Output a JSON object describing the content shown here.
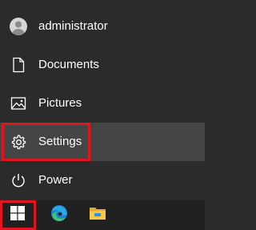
{
  "start_menu": {
    "items": [
      {
        "label": "administrator",
        "icon": "user-avatar-icon"
      },
      {
        "label": "Documents",
        "icon": "document-icon"
      },
      {
        "label": "Pictures",
        "icon": "picture-icon"
      },
      {
        "label": "Settings",
        "icon": "gear-icon"
      },
      {
        "label": "Power",
        "icon": "power-icon"
      }
    ],
    "highlighted_item": "Settings"
  },
  "taskbar": {
    "buttons": [
      {
        "name": "start",
        "icon": "windows-logo-icon"
      },
      {
        "name": "edge",
        "icon": "edge-browser-icon"
      },
      {
        "name": "file-explorer",
        "icon": "folder-icon"
      }
    ]
  },
  "colors": {
    "menu_bg": "#2b2b2b",
    "hover_bg": "#454545",
    "taskbar_bg": "#202020",
    "highlight_border": "#e1151f",
    "windows_logo": "#ffffff"
  }
}
